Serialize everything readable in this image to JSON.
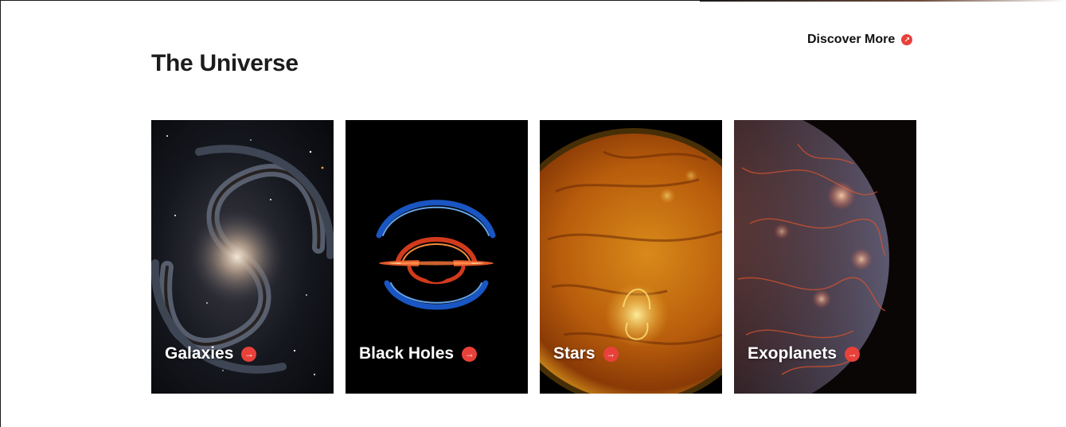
{
  "header": {
    "title": "The Universe",
    "discover_label": "Discover More",
    "discover_icon": "arrow-up-right-icon"
  },
  "colors": {
    "accent": "#e8413a",
    "title_text": "#1c1c1c",
    "card_text": "#ffffff"
  },
  "cards": [
    {
      "label": "Galaxies",
      "image": "spiral-galaxy-image",
      "icon": "arrow-right-icon"
    },
    {
      "label": "Black Holes",
      "image": "black-hole-image",
      "icon": "arrow-right-icon"
    },
    {
      "label": "Stars",
      "image": "sun-star-image",
      "icon": "arrow-right-icon"
    },
    {
      "label": "Exoplanets",
      "image": "exoplanet-image",
      "icon": "arrow-right-icon"
    }
  ]
}
